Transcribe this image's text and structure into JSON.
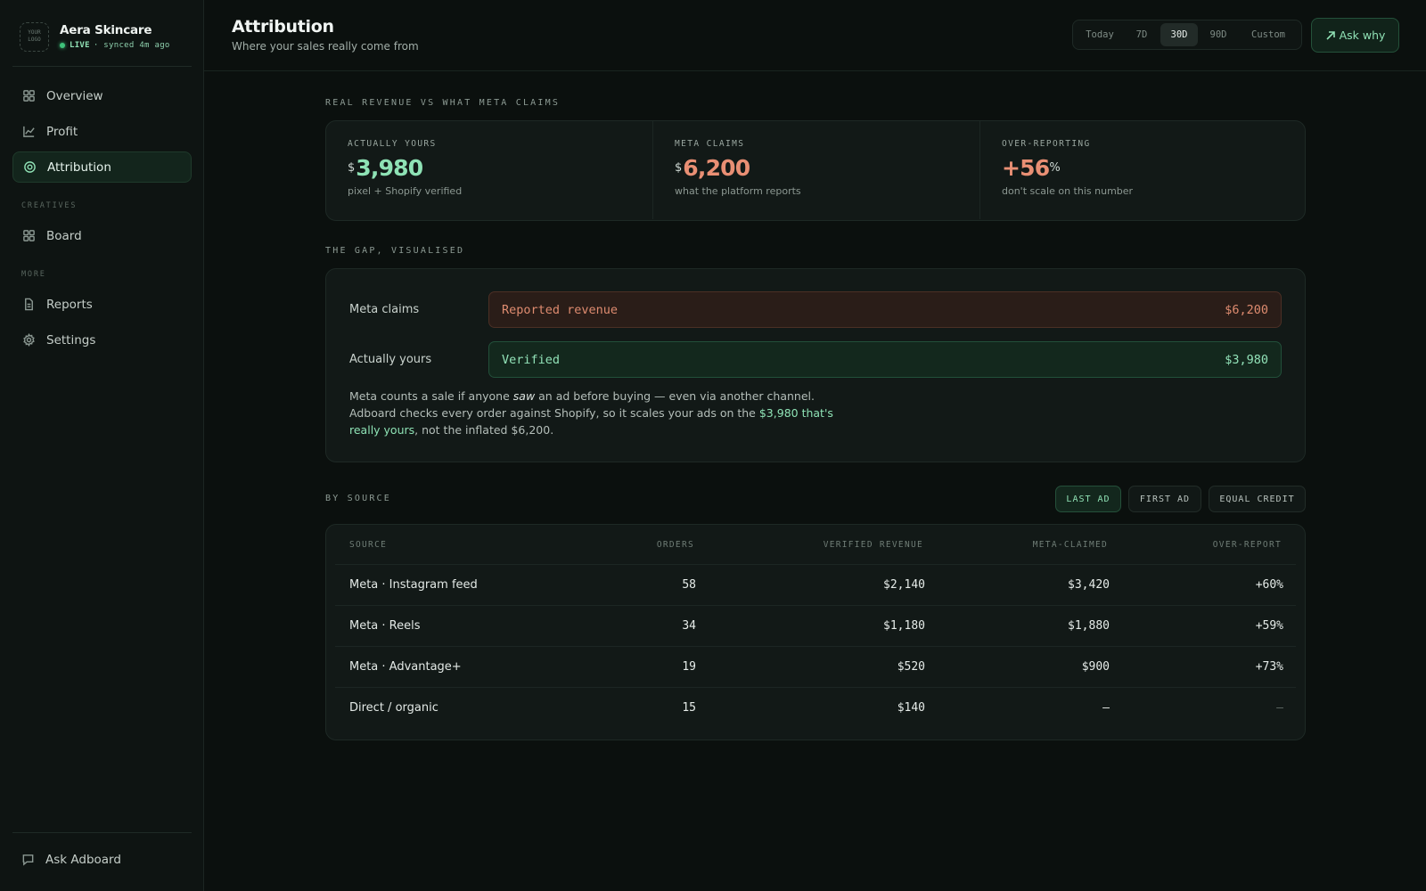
{
  "brand": {
    "logo_line1": "YOUR",
    "logo_line2": "LOGO",
    "name": "Aera Skincare",
    "live": "LIVE",
    "synced": "· synced 4m ago"
  },
  "sidebar": {
    "items": [
      {
        "label": "Overview",
        "icon": "grid-icon"
      },
      {
        "label": "Profit",
        "icon": "chart-line-icon"
      },
      {
        "label": "Attribution",
        "icon": "target-icon",
        "active": true
      }
    ],
    "sections": [
      {
        "label": "CREATIVES",
        "items": [
          {
            "label": "Board",
            "icon": "grid-icon"
          }
        ]
      },
      {
        "label": "MORE",
        "items": [
          {
            "label": "Reports",
            "icon": "document-icon"
          },
          {
            "label": "Settings",
            "icon": "gear-icon"
          }
        ]
      }
    ],
    "footer_label": "Ask Adboard"
  },
  "header": {
    "title": "Attribution",
    "subtitle": "Where your sales really come from",
    "ranges": [
      "Today",
      "7D",
      "30D",
      "90D",
      "Custom"
    ],
    "active_range": "30D",
    "ask_label": "Ask why"
  },
  "kpis": {
    "section_title": "REAL REVENUE VS WHAT META CLAIMS",
    "items": [
      {
        "label": "ACTUALLY YOURS",
        "prefix": "$",
        "value": "3,980",
        "suffix": "",
        "note": "pixel + Shopify verified"
      },
      {
        "label": "META CLAIMS",
        "prefix": "$",
        "value": "6,200",
        "suffix": "",
        "note": "what the platform reports"
      },
      {
        "label": "OVER-REPORTING",
        "prefix": "",
        "value": "+56",
        "suffix": "%",
        "note": "don't scale on this number"
      }
    ]
  },
  "gap": {
    "section_title": "THE GAP, VISUALISED",
    "rows": [
      {
        "label": "Meta claims",
        "bar_label": "Reported revenue",
        "bar_value": "$6,200"
      },
      {
        "label": "Actually yours",
        "bar_label": "Verified",
        "bar_value": "$3,980"
      }
    ],
    "text_1": "Meta counts a sale if anyone ",
    "text_em": "saw",
    "text_2": " an ad before buying — even via another channel. Adboard checks every order against Shopify, so it scales your ads on the ",
    "text_hl": "$3,980 that's really yours",
    "text_3": ", not the inflated $6,200."
  },
  "by_source": {
    "section_title": "BY SOURCE",
    "models": [
      "LAST AD",
      "FIRST AD",
      "EQUAL CREDIT"
    ],
    "active_model": "LAST AD",
    "columns": [
      "SOURCE",
      "ORDERS",
      "VERIFIED REVENUE",
      "META-CLAIMED",
      "OVER-REPORT"
    ],
    "rows": [
      [
        "Meta · Instagram feed",
        "58",
        "$2,140",
        "$3,420",
        "+60%"
      ],
      [
        "Meta · Reels",
        "34",
        "$1,180",
        "$1,880",
        "+59%"
      ],
      [
        "Meta · Advantage+",
        "19",
        "$520",
        "$900",
        "+73%"
      ],
      [
        "Direct / organic",
        "15",
        "$140",
        "—",
        "—"
      ]
    ]
  },
  "colors": {
    "accent_green": "#8ee2b5",
    "accent_red": "#e98f74",
    "background": "#0b100e"
  }
}
